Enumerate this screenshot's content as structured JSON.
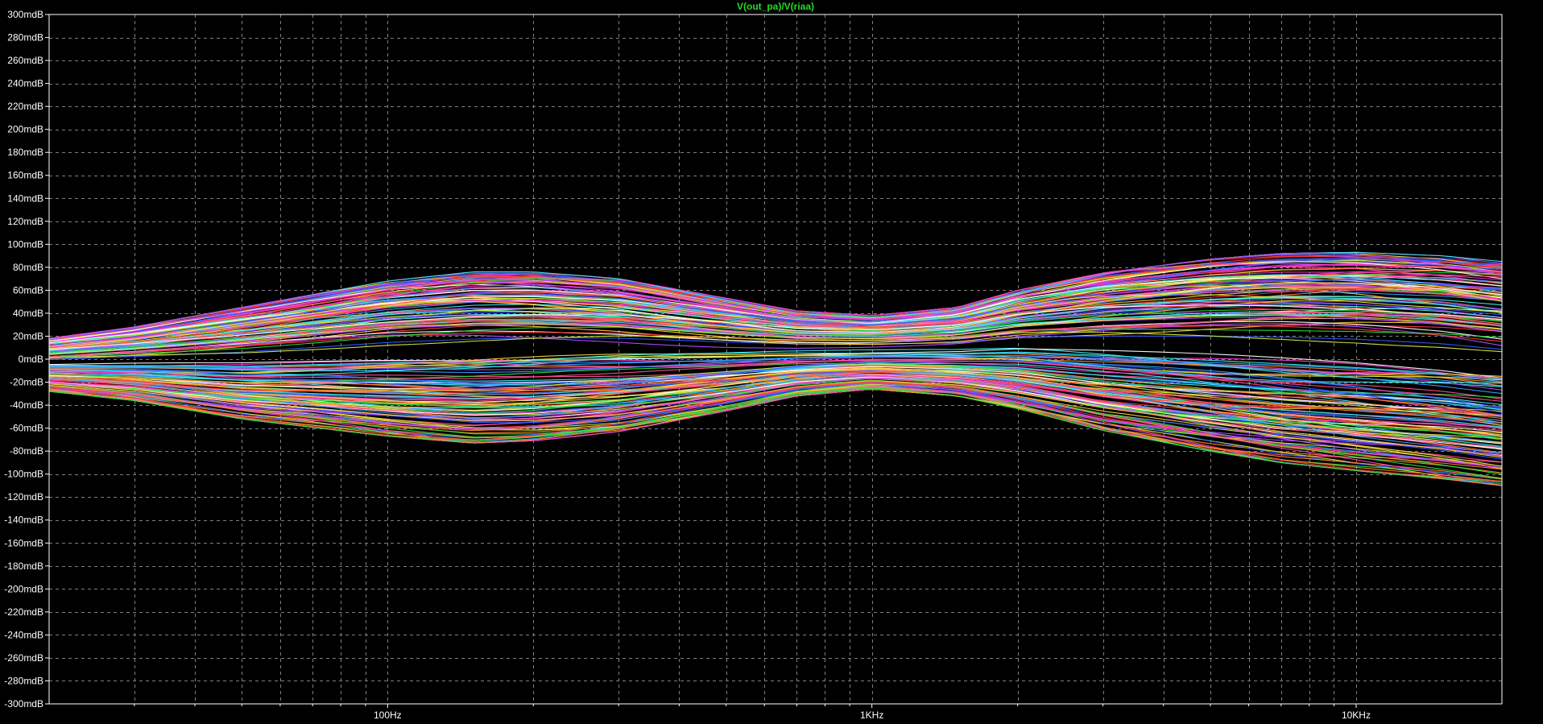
{
  "chart_data": {
    "type": "line",
    "title": "V(out_pa)/V(riaa)",
    "xlabel": "",
    "ylabel": "",
    "x_scale": "log",
    "xlim": [
      20,
      20000
    ],
    "ylim": [
      -300,
      300
    ],
    "y_unit": "mdB",
    "grid": true,
    "legend": "none",
    "x_ticks": [
      {
        "value": 100,
        "label": "100Hz"
      },
      {
        "value": 1000,
        "label": "1KHz"
      },
      {
        "value": 10000,
        "label": "10KHz"
      }
    ],
    "y_ticks": [
      {
        "value": 300,
        "label": "300mdB"
      },
      {
        "value": 280,
        "label": "280mdB"
      },
      {
        "value": 260,
        "label": "260mdB"
      },
      {
        "value": 240,
        "label": "240mdB"
      },
      {
        "value": 220,
        "label": "220mdB"
      },
      {
        "value": 200,
        "label": "200mdB"
      },
      {
        "value": 180,
        "label": "180mdB"
      },
      {
        "value": 160,
        "label": "160mdB"
      },
      {
        "value": 140,
        "label": "140mdB"
      },
      {
        "value": 120,
        "label": "120mdB"
      },
      {
        "value": 100,
        "label": "100mdB"
      },
      {
        "value": 80,
        "label": "80mdB"
      },
      {
        "value": 60,
        "label": "60mdB"
      },
      {
        "value": 40,
        "label": "40mdB"
      },
      {
        "value": 20,
        "label": "20mdB"
      },
      {
        "value": 0,
        "label": "0mdB"
      },
      {
        "value": -20,
        "label": "-20mdB"
      },
      {
        "value": -40,
        "label": "-40mdB"
      },
      {
        "value": -60,
        "label": "-60mdB"
      },
      {
        "value": -80,
        "label": "-80mdB"
      },
      {
        "value": -100,
        "label": "-100mdB"
      },
      {
        "value": -120,
        "label": "-120mdB"
      },
      {
        "value": -140,
        "label": "-140mdB"
      },
      {
        "value": -160,
        "label": "-160mdB"
      },
      {
        "value": -180,
        "label": "-180mdB"
      },
      {
        "value": -200,
        "label": "-200mdB"
      },
      {
        "value": -220,
        "label": "-220mdB"
      },
      {
        "value": -240,
        "label": "-240mdB"
      },
      {
        "value": -260,
        "label": "-260mdB"
      },
      {
        "value": -280,
        "label": "-280mdB"
      },
      {
        "value": -300,
        "label": "-300mdB"
      }
    ],
    "envelope": {
      "x": [
        20,
        30,
        50,
        100,
        150,
        200,
        300,
        500,
        700,
        1000,
        1500,
        2000,
        3000,
        5000,
        7000,
        10000,
        15000,
        20000
      ],
      "upper": [
        18,
        28,
        45,
        68,
        76,
        76,
        70,
        53,
        42,
        38,
        45,
        60,
        75,
        87,
        92,
        93,
        90,
        85
      ],
      "lower": [
        -28,
        -36,
        -52,
        -67,
        -73,
        -71,
        -63,
        -45,
        -32,
        -26,
        -32,
        -43,
        -62,
        -80,
        -90,
        -97,
        -104,
        -110
      ]
    },
    "run_count": 200,
    "colors": {
      "background": "#000000",
      "grid": "#7f7f7f",
      "axes": "#ffffff",
      "title": "#23dc23",
      "palette": [
        "#ff3b3b",
        "#2e5bff",
        "#28e03c",
        "#ff3cd0",
        "#ffd23a",
        "#3cf0f0",
        "#b24bff",
        "#ff8a2a",
        "#ffffff",
        "#d8e83a",
        "#ff4f8f",
        "#35a0ff"
      ]
    }
  }
}
